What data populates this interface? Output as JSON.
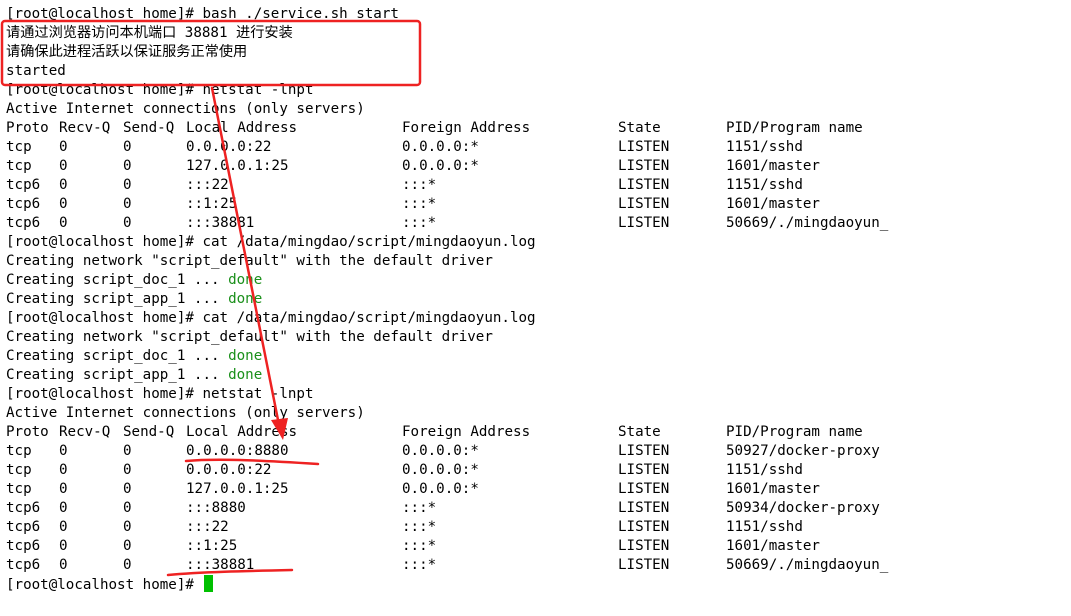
{
  "terminal": {
    "lines": [
      {
        "text": "[root@localhost home]# bash ./service.sh start"
      },
      {
        "text": "请通过浏览器访问本机端口 38881 进行安装"
      },
      {
        "text": "请确保此进程活跃以保证服务正常使用"
      },
      {
        "text": "started"
      },
      {
        "text": "[root@localhost home]# netstat -lnpt"
      },
      {
        "text": "Active Internet connections (only servers)"
      },
      {
        "cols": [
          "Proto",
          "Recv-Q",
          "Send-Q",
          "Local Address",
          "Foreign Address",
          "State",
          "PID/Program name"
        ]
      },
      {
        "cols": [
          "tcp",
          "0",
          "0",
          "0.0.0.0:22",
          "0.0.0.0:*",
          "LISTEN",
          "1151/sshd"
        ]
      },
      {
        "cols": [
          "tcp",
          "0",
          "0",
          "127.0.0.1:25",
          "0.0.0.0:*",
          "LISTEN",
          "1601/master"
        ]
      },
      {
        "cols": [
          "tcp6",
          "0",
          "0",
          ":::22",
          ":::*",
          "LISTEN",
          "1151/sshd"
        ]
      },
      {
        "cols": [
          "tcp6",
          "0",
          "0",
          "::1:25",
          ":::*",
          "LISTEN",
          "1601/master"
        ]
      },
      {
        "cols": [
          "tcp6",
          "0",
          "0",
          ":::38881",
          ":::*",
          "LISTEN",
          "50669/./mingdaoyun_"
        ]
      },
      {
        "text": "[root@localhost home]# cat /data/mingdao/script/mingdaoyun.log"
      },
      {
        "text": "Creating network \"script_default\" with the default driver"
      },
      {
        "text": "Creating script_doc_1 ... ",
        "status": "done"
      },
      {
        "text": "Creating script_app_1 ... ",
        "status": "done"
      },
      {
        "text": "[root@localhost home]# cat /data/mingdao/script/mingdaoyun.log"
      },
      {
        "text": "Creating network \"script_default\" with the default driver"
      },
      {
        "text": "Creating script_doc_1 ... ",
        "status": "done"
      },
      {
        "text": "Creating script_app_1 ... ",
        "status": "done"
      },
      {
        "text": "[root@localhost home]# netstat -lnpt"
      },
      {
        "text": "Active Internet connections (only servers)"
      },
      {
        "cols": [
          "Proto",
          "Recv-Q",
          "Send-Q",
          "Local Address",
          "Foreign Address",
          "State",
          "PID/Program name"
        ]
      },
      {
        "cols": [
          "tcp",
          "0",
          "0",
          "0.0.0.0:8880",
          "0.0.0.0:*",
          "LISTEN",
          "50927/docker-proxy"
        ]
      },
      {
        "cols": [
          "tcp",
          "0",
          "0",
          "0.0.0.0:22",
          "0.0.0.0:*",
          "LISTEN",
          "1151/sshd"
        ]
      },
      {
        "cols": [
          "tcp",
          "0",
          "0",
          "127.0.0.1:25",
          "0.0.0.0:*",
          "LISTEN",
          "1601/master"
        ]
      },
      {
        "cols": [
          "tcp6",
          "0",
          "0",
          ":::8880",
          ":::*",
          "LISTEN",
          "50934/docker-proxy"
        ]
      },
      {
        "cols": [
          "tcp6",
          "0",
          "0",
          ":::22",
          ":::*",
          "LISTEN",
          "1151/sshd"
        ]
      },
      {
        "cols": [
          "tcp6",
          "0",
          "0",
          "::1:25",
          ":::*",
          "LISTEN",
          "1601/master"
        ]
      },
      {
        "cols": [
          "tcp6",
          "0",
          "0",
          ":::38881",
          ":::*",
          "LISTEN",
          "50669/./mingdaoyun_"
        ]
      },
      {
        "text": "[root@localhost home]# ",
        "cursor": true
      }
    ]
  },
  "annotation_color": "#ee2222",
  "status_color": "#1a8f1a",
  "cursor_color": "#00c000"
}
